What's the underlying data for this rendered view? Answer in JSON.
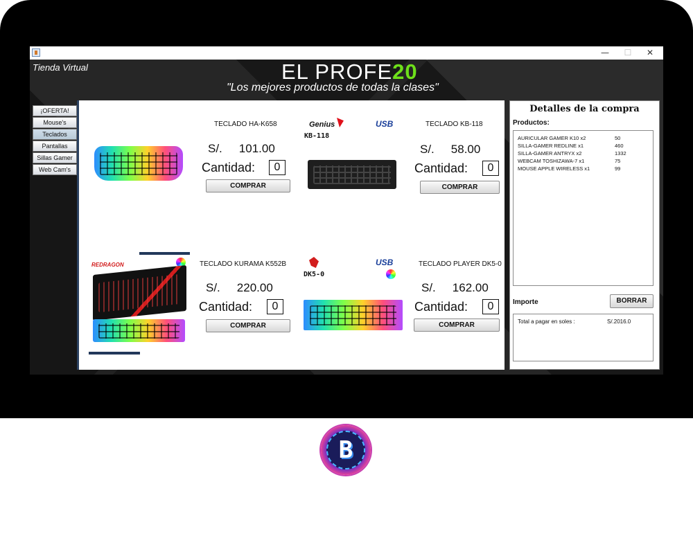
{
  "window": {
    "minimize": "—",
    "maximize": "☐",
    "close": "✕"
  },
  "header": {
    "store_label": "Tienda Virtual",
    "brand_prefix": "EL  PROFE",
    "brand_number": "20",
    "slogan": "\"Los mejores productos de todas la clases\""
  },
  "nav": [
    {
      "label": "¡OFERTA!",
      "active": false
    },
    {
      "label": "Mouse's",
      "active": false
    },
    {
      "label": "Teclados",
      "active": true
    },
    {
      "label": "Pantallas",
      "active": false
    },
    {
      "label": "Sillas Gamer",
      "active": false
    },
    {
      "label": "Web Cam's",
      "active": false
    }
  ],
  "products": [
    {
      "name": "TECLADO HA-K658",
      "currency": "S/.",
      "price": "101.00",
      "qty_label": "Cantidad:",
      "qty": "0",
      "buy": "COMPRAR"
    },
    {
      "name": "TECLADO KB-118",
      "currency": "S/.",
      "price": "58.00",
      "qty_label": "Cantidad:",
      "qty": "0",
      "buy": "COMPRAR",
      "brand": "Genius",
      "model": "KB-118",
      "usb": "USB"
    },
    {
      "name": "TECLADO KURAMA K552B",
      "currency": "S/.",
      "price": "220.00",
      "qty_label": "Cantidad:",
      "qty": "0",
      "buy": "COMPRAR",
      "brand": "REDRAGON"
    },
    {
      "name": "TECLADO PLAYER DK5-0",
      "currency": "S/.",
      "price": "162.00",
      "qty_label": "Cantidad:",
      "qty": "0",
      "buy": "COMPRAR",
      "model": "DK5-0",
      "usb": "USB"
    }
  ],
  "details": {
    "title": "Detalles de la compra",
    "products_label": "Productos:",
    "items": [
      {
        "name": "AURICULAR GAMER K10  x2",
        "price": "50"
      },
      {
        "name": "SILLA-GAMER REDLINE    x1",
        "price": "460"
      },
      {
        "name": "SILLA-GAMER ANTRYX   x2",
        "price": "1332"
      },
      {
        "name": "WEBCAM TOSHIZAWA-7  x1",
        "price": "75"
      },
      {
        "name": "MOUSE APPLE WIRELESS x1",
        "price": "99"
      }
    ],
    "importe_label": "Importe",
    "clear_button": "BORRAR",
    "total_label": "Total a pagar en soles :",
    "total_value": "S/.2016.0"
  },
  "colors": {
    "brand_accent": "#6ee01a",
    "panel_border": "#2b4160",
    "bezel": "#000000"
  }
}
